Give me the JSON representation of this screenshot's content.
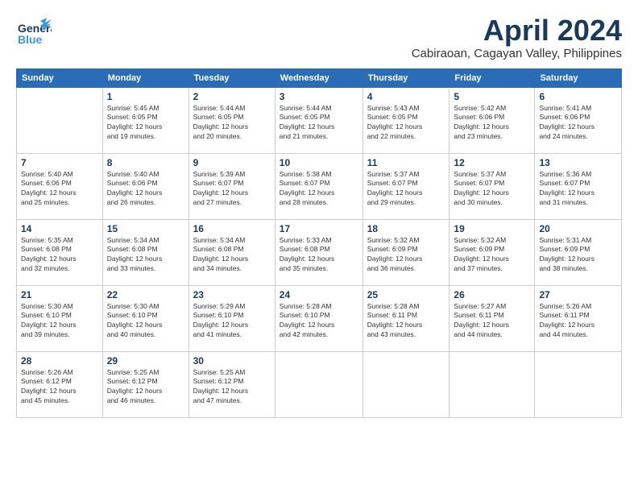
{
  "header": {
    "logo_line1": "General",
    "logo_line2": "Blue",
    "month_title": "April 2024",
    "subtitle": "Cabiraoan, Cagayan Valley, Philippines"
  },
  "weekdays": [
    "Sunday",
    "Monday",
    "Tuesday",
    "Wednesday",
    "Thursday",
    "Friday",
    "Saturday"
  ],
  "weeks": [
    [
      {
        "day": "",
        "info": ""
      },
      {
        "day": "1",
        "info": "Sunrise: 5:45 AM\nSunset: 6:05 PM\nDaylight: 12 hours\nand 19 minutes."
      },
      {
        "day": "2",
        "info": "Sunrise: 5:44 AM\nSunset: 6:05 PM\nDaylight: 12 hours\nand 20 minutes."
      },
      {
        "day": "3",
        "info": "Sunrise: 5:44 AM\nSunset: 6:05 PM\nDaylight: 12 hours\nand 21 minutes."
      },
      {
        "day": "4",
        "info": "Sunrise: 5:43 AM\nSunset: 6:05 PM\nDaylight: 12 hours\nand 22 minutes."
      },
      {
        "day": "5",
        "info": "Sunrise: 5:42 AM\nSunset: 6:06 PM\nDaylight: 12 hours\nand 23 minutes."
      },
      {
        "day": "6",
        "info": "Sunrise: 5:41 AM\nSunset: 6:06 PM\nDaylight: 12 hours\nand 24 minutes."
      }
    ],
    [
      {
        "day": "7",
        "info": "Sunrise: 5:40 AM\nSunset: 6:06 PM\nDaylight: 12 hours\nand 25 minutes."
      },
      {
        "day": "8",
        "info": "Sunrise: 5:40 AM\nSunset: 6:06 PM\nDaylight: 12 hours\nand 26 minutes."
      },
      {
        "day": "9",
        "info": "Sunrise: 5:39 AM\nSunset: 6:07 PM\nDaylight: 12 hours\nand 27 minutes."
      },
      {
        "day": "10",
        "info": "Sunrise: 5:38 AM\nSunset: 6:07 PM\nDaylight: 12 hours\nand 28 minutes."
      },
      {
        "day": "11",
        "info": "Sunrise: 5:37 AM\nSunset: 6:07 PM\nDaylight: 12 hours\nand 29 minutes."
      },
      {
        "day": "12",
        "info": "Sunrise: 5:37 AM\nSunset: 6:07 PM\nDaylight: 12 hours\nand 30 minutes."
      },
      {
        "day": "13",
        "info": "Sunrise: 5:36 AM\nSunset: 6:07 PM\nDaylight: 12 hours\nand 31 minutes."
      }
    ],
    [
      {
        "day": "14",
        "info": "Sunrise: 5:35 AM\nSunset: 6:08 PM\nDaylight: 12 hours\nand 32 minutes."
      },
      {
        "day": "15",
        "info": "Sunrise: 5:34 AM\nSunset: 6:08 PM\nDaylight: 12 hours\nand 33 minutes."
      },
      {
        "day": "16",
        "info": "Sunrise: 5:34 AM\nSunset: 6:08 PM\nDaylight: 12 hours\nand 34 minutes."
      },
      {
        "day": "17",
        "info": "Sunrise: 5:33 AM\nSunset: 6:08 PM\nDaylight: 12 hours\nand 35 minutes."
      },
      {
        "day": "18",
        "info": "Sunrise: 5:32 AM\nSunset: 6:09 PM\nDaylight: 12 hours\nand 36 minutes."
      },
      {
        "day": "19",
        "info": "Sunrise: 5:32 AM\nSunset: 6:09 PM\nDaylight: 12 hours\nand 37 minutes."
      },
      {
        "day": "20",
        "info": "Sunrise: 5:31 AM\nSunset: 6:09 PM\nDaylight: 12 hours\nand 38 minutes."
      }
    ],
    [
      {
        "day": "21",
        "info": "Sunrise: 5:30 AM\nSunset: 6:10 PM\nDaylight: 12 hours\nand 39 minutes."
      },
      {
        "day": "22",
        "info": "Sunrise: 5:30 AM\nSunset: 6:10 PM\nDaylight: 12 hours\nand 40 minutes."
      },
      {
        "day": "23",
        "info": "Sunrise: 5:29 AM\nSunset: 6:10 PM\nDaylight: 12 hours\nand 41 minutes."
      },
      {
        "day": "24",
        "info": "Sunrise: 5:28 AM\nSunset: 6:10 PM\nDaylight: 12 hours\nand 42 minutes."
      },
      {
        "day": "25",
        "info": "Sunrise: 5:28 AM\nSunset: 6:11 PM\nDaylight: 12 hours\nand 43 minutes."
      },
      {
        "day": "26",
        "info": "Sunrise: 5:27 AM\nSunset: 6:11 PM\nDaylight: 12 hours\nand 44 minutes."
      },
      {
        "day": "27",
        "info": "Sunrise: 5:26 AM\nSunset: 6:11 PM\nDaylight: 12 hours\nand 44 minutes."
      }
    ],
    [
      {
        "day": "28",
        "info": "Sunrise: 5:26 AM\nSunset: 6:12 PM\nDaylight: 12 hours\nand 45 minutes."
      },
      {
        "day": "29",
        "info": "Sunrise: 5:25 AM\nSunset: 6:12 PM\nDaylight: 12 hours\nand 46 minutes."
      },
      {
        "day": "30",
        "info": "Sunrise: 5:25 AM\nSunset: 6:12 PM\nDaylight: 12 hours\nand 47 minutes."
      },
      {
        "day": "",
        "info": ""
      },
      {
        "day": "",
        "info": ""
      },
      {
        "day": "",
        "info": ""
      },
      {
        "day": "",
        "info": ""
      }
    ]
  ]
}
